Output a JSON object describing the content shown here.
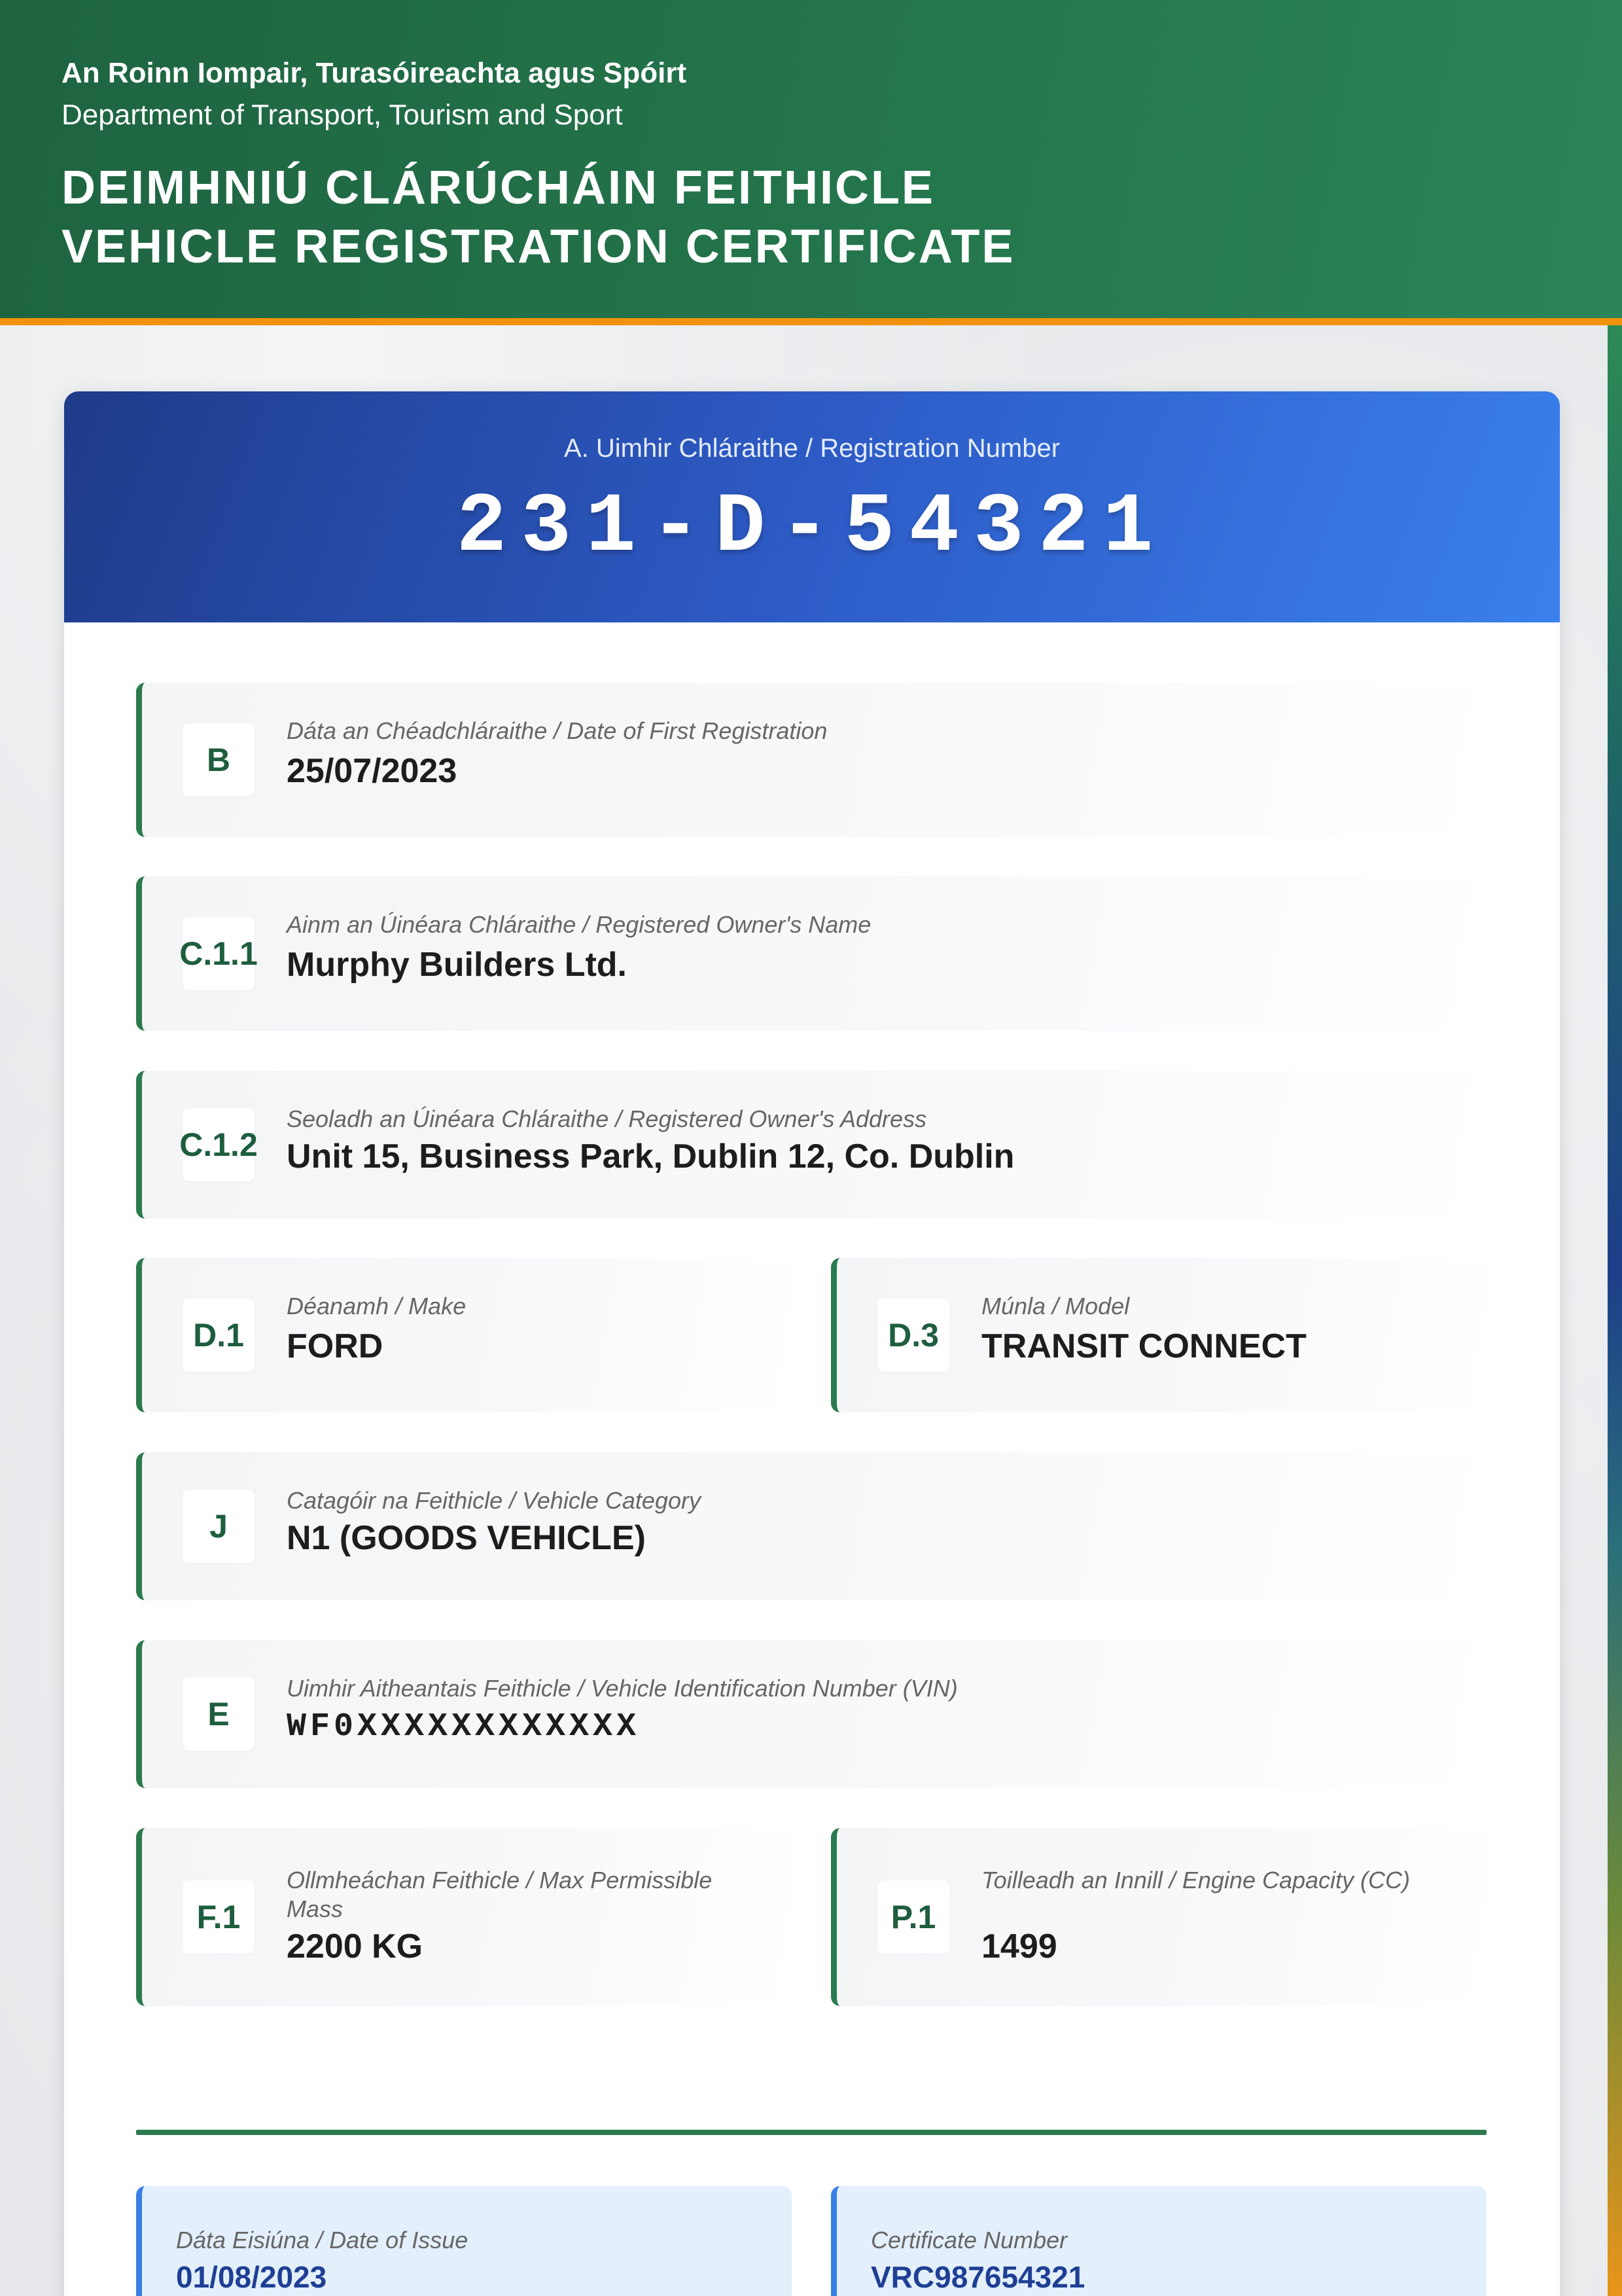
{
  "header": {
    "dept_ga": "An Roinn Iompair, Turasóireachta agus Spóirt",
    "dept_en": "Department of Transport, Tourism and Sport",
    "title_ga": "DEIMHNIÚ CLÁRÚCHÁIN FEITHICLE",
    "title_en": "VEHICLE REGISTRATION CERTIFICATE"
  },
  "registration": {
    "label": "A. Uimhir Chláraithe / Registration Number",
    "number": "231-D-54321"
  },
  "fields": {
    "b": {
      "code": "B",
      "label": "Dáta an Chéadchláraithe / Date of First Registration",
      "value": "25/07/2023"
    },
    "c11": {
      "code": "C.1.1",
      "label": "Ainm an Úinéara Chláraithe / Registered Owner's Name",
      "value": "Murphy Builders Ltd."
    },
    "c12": {
      "code": "C.1.2",
      "label": "Seoladh an Úinéara Chláraithe / Registered Owner's Address",
      "value": "Unit 15, Business Park, Dublin 12, Co. Dublin"
    },
    "d1": {
      "code": "D.1",
      "label": "Déanamh / Make",
      "value": "FORD"
    },
    "d3": {
      "code": "D.3",
      "label": "Múnla / Model",
      "value": "TRANSIT CONNECT"
    },
    "j": {
      "code": "J",
      "label": "Catagóir na Feithicle / Vehicle Category",
      "value": "N1 (GOODS VEHICLE)"
    },
    "e": {
      "code": "E",
      "label": "Uimhir Aitheantais Feithicle / Vehicle Identification Number (VIN)",
      "value": "WF0XXXXXXXXXXXX"
    },
    "f1": {
      "code": "F.1",
      "label": "Ollmheáchan Feithicle / Max Permissible Mass",
      "value": "2200 KG"
    },
    "p1": {
      "code": "P.1",
      "label": "Toilleadh an Innill / Engine Capacity (CC)",
      "value": "1499"
    }
  },
  "issue": {
    "date_label": "Dáta Eisiúna / Date of Issue",
    "date_value": "01/08/2023",
    "cert_label": "Certificate Number",
    "cert_value": "VRC987654321"
  },
  "colors": {
    "header_green": "#23744b",
    "accent_orange": "#f0920e",
    "banner_blue": "#2d5bc6",
    "field_border_green": "#2a7a4e",
    "issue_box_bg": "#e3f0fb",
    "issue_value_blue": "#1f3f95"
  }
}
